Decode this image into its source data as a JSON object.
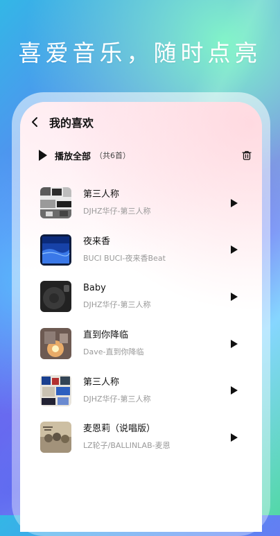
{
  "slogan": "喜爱音乐，随时点亮",
  "header": {
    "title": "我的喜欢",
    "back_icon": "chevron-left-icon"
  },
  "playall": {
    "label": "播放全部",
    "count": "（共6首）",
    "icon": "play-icon",
    "trash_icon": "trash-icon"
  },
  "colors": {
    "accent": "#7b6cf1",
    "text_primary": "#111111",
    "text_secondary": "#999999"
  },
  "songs": [
    {
      "title": "第三人称",
      "artist": "DJHZ华仔-第三人称",
      "cover": "cover-collage-gray"
    },
    {
      "title": "夜来香",
      "artist": "BUCI BUCI-夜来香Beat",
      "cover": "cover-blue-sea"
    },
    {
      "title": "Baby",
      "artist": "DJHZ华仔-第三人称",
      "cover": "cover-dark"
    },
    {
      "title": "直到你降临",
      "artist": "Dave-直到你降临",
      "cover": "cover-candle"
    },
    {
      "title": "第三人称",
      "artist": "DJHZ华仔-第三人称",
      "cover": "cover-collage-blue"
    },
    {
      "title": "麦恩莉（说唱版）",
      "artist": "LZ轮子/BALLINLAB-麦恩",
      "cover": "cover-sepia-photo"
    }
  ]
}
